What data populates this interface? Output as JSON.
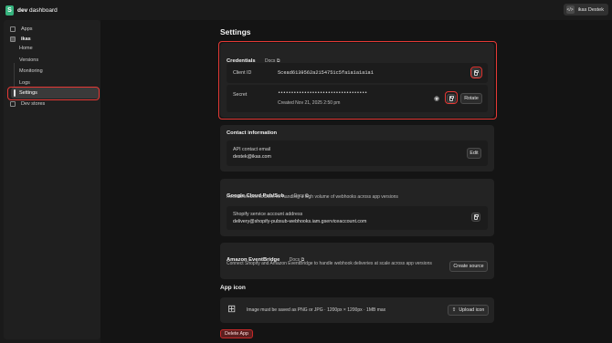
{
  "app": {
    "brand": "dev",
    "title": "dashboard",
    "user_code": "</>",
    "user_name": "ikas Destek"
  },
  "sidebar": {
    "apps": "Apps",
    "ikas": "ikas",
    "home": "Home",
    "versions": "Versions",
    "monitoring": "Monitoring",
    "logs": "Logs",
    "settings": "Settings",
    "dev_stores": "Dev stores"
  },
  "page": {
    "title": "Settings"
  },
  "credentials": {
    "title": "Credentials",
    "docs": "Docs",
    "client_id_label": "Client ID",
    "client_id_value": "5cead6139562a2154751c5fa1a1a1a1a1",
    "secret_label": "Secret",
    "secret_value": "••••••••••••••••••••••••••••••••••",
    "created": "Created Nov 21, 2025 2:50 pm",
    "rotate_label": "Rotate"
  },
  "contact": {
    "title": "Contact information",
    "api_label": "API contact email",
    "api_email": "destek@ikas.com",
    "edit_label": "Edit"
  },
  "pubsub": {
    "title": "Google Cloud Pub/Sub",
    "docs": "Docs",
    "desc": "Recommended solution for handling a high volume of webhooks across app versions",
    "account_label": "Shopify service account address",
    "account_value": "delivery@shopify-pubsub-webhooks.iam.gserviceaccount.com"
  },
  "eventbridge": {
    "title": "Amazon EventBridge",
    "docs": "Docs",
    "desc": "Connect Shopify and Amazon EventBridge to handle webhook deliveries at scale across app versions",
    "create_label": "Create source"
  },
  "app_icon": {
    "title": "App icon",
    "hint": "Image must be saved as PNG or JPG · 1200px × 1200px · 1MB max",
    "upload_label": "Upload icon"
  },
  "delete_label": "Delete App",
  "colors": {
    "highlight": "#e53935",
    "danger": "#c62828"
  }
}
